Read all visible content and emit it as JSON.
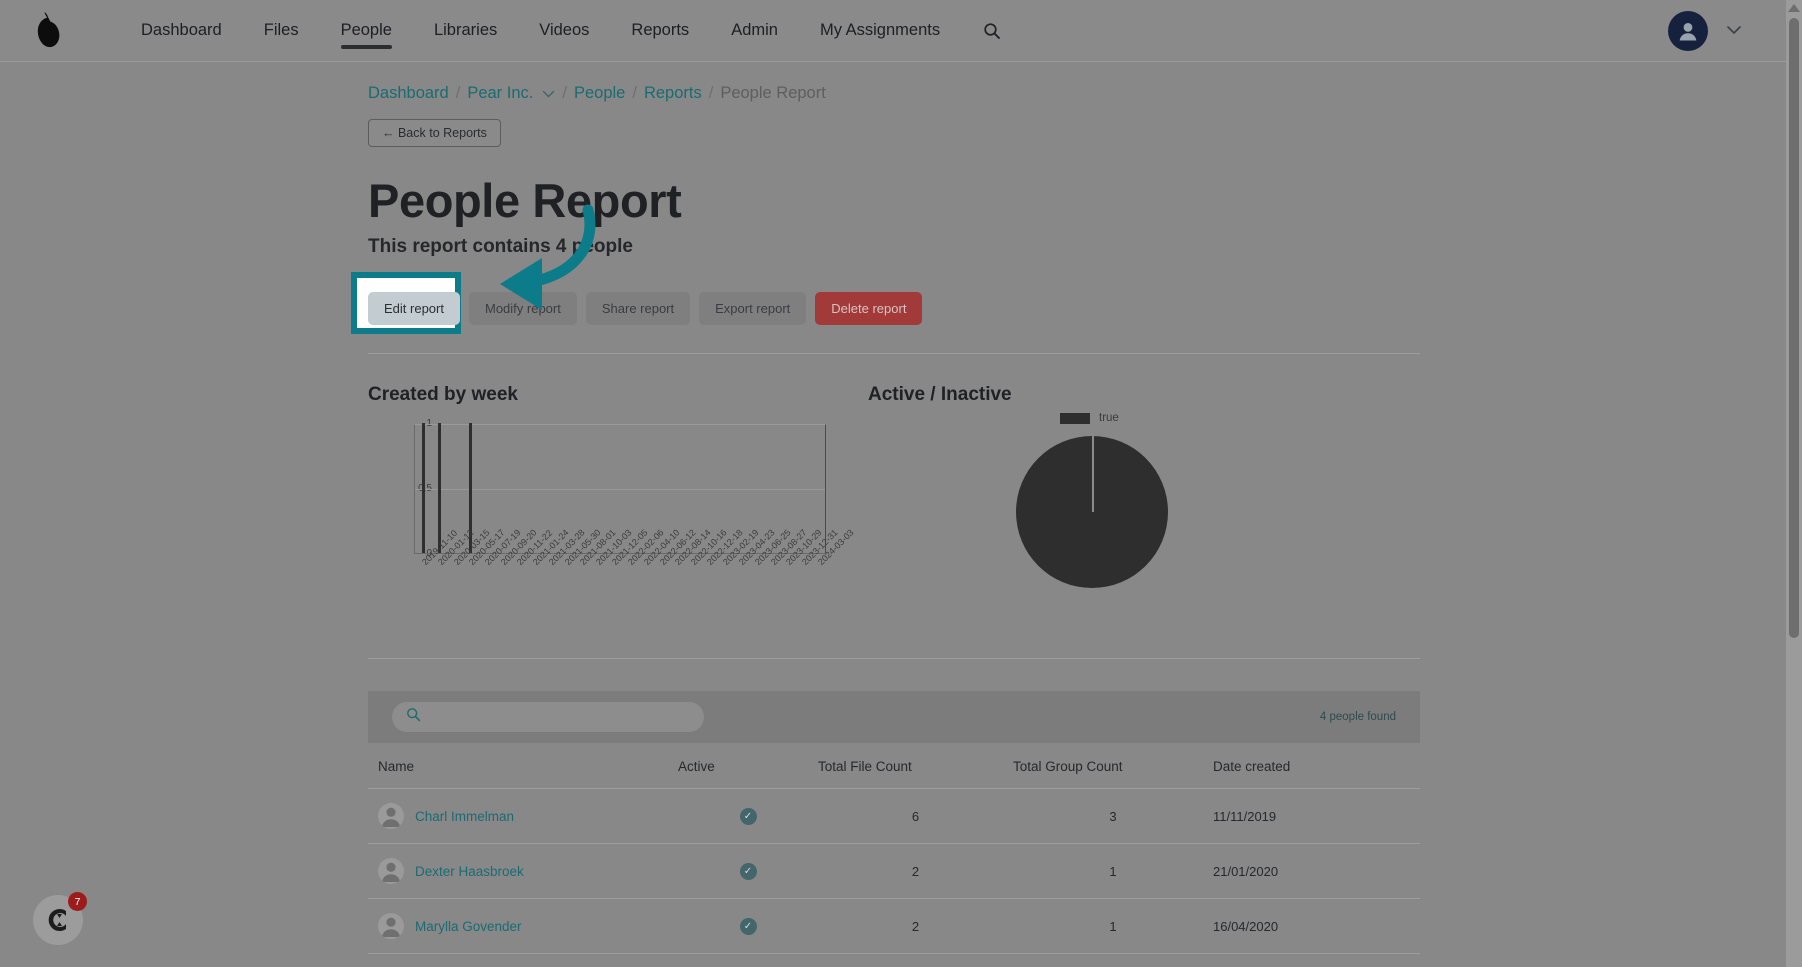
{
  "navbar": {
    "logo_icon": "pear-logo-icon",
    "items": [
      {
        "label": "Dashboard",
        "active": false
      },
      {
        "label": "Files",
        "active": false
      },
      {
        "label": "People",
        "active": true
      },
      {
        "label": "Libraries",
        "active": false
      },
      {
        "label": "Videos",
        "active": false
      },
      {
        "label": "Reports",
        "active": false
      },
      {
        "label": "Admin",
        "active": false
      },
      {
        "label": "My Assignments",
        "active": false
      }
    ],
    "search_icon": "search-icon",
    "account_icon": "user-avatar-icon",
    "account_caret": "⌄"
  },
  "breadcrumb": {
    "items": [
      {
        "label": "Dashboard",
        "current": false
      },
      {
        "label": "Pear Inc.",
        "current": false,
        "caret": true
      },
      {
        "label": "People",
        "current": false
      },
      {
        "label": "Reports",
        "current": false
      },
      {
        "label": "People Report",
        "current": true
      }
    ],
    "separator": "/"
  },
  "back_button": {
    "label": "← Back to Reports"
  },
  "header": {
    "title": "People Report",
    "subtitle": "This report contains 4 people"
  },
  "actions": [
    {
      "label": "Edit report",
      "style": "primary",
      "name": "edit-report-button"
    },
    {
      "label": "Modify report",
      "style": "default",
      "name": "modify-report-button"
    },
    {
      "label": "Share report",
      "style": "default",
      "name": "share-report-button"
    },
    {
      "label": "Export report",
      "style": "default",
      "name": "export-report-button"
    },
    {
      "label": "Delete report",
      "style": "danger",
      "name": "delete-report-button"
    }
  ],
  "annotation": {
    "highlight_target": "Edit report",
    "highlight_color": "#0d7c8a",
    "arrow_color": "#0d7c8a"
  },
  "charts": {
    "bar_title": "Created by week",
    "pie_title": "Active / Inactive"
  },
  "chart_data": [
    {
      "type": "bar",
      "title": "Created by week",
      "xlabel": "",
      "ylabel": "",
      "ylim": [
        0,
        1
      ],
      "yticks": [
        "0",
        "0.5",
        "1"
      ],
      "grid": true,
      "categories": [
        "2019-11-10",
        "2020-01-12",
        "2020-03-15",
        "2020-05-17",
        "2020-07-19",
        "2020-09-20",
        "2020-11-22",
        "2021-01-24",
        "2021-03-28",
        "2021-05-30",
        "2021-08-01",
        "2021-10-03",
        "2021-12-05",
        "2022-02-06",
        "2022-04-10",
        "2022-06-12",
        "2022-08-14",
        "2022-10-16",
        "2022-12-18",
        "2023-02-19",
        "2023-04-23",
        "2023-06-25",
        "2023-08-27",
        "2023-10-29",
        "2023-12-31",
        "2024-03-03"
      ],
      "values": [
        1,
        1,
        0,
        1,
        0,
        0,
        0,
        0,
        0,
        0,
        0,
        0,
        0,
        0,
        0,
        0,
        0,
        0,
        0,
        0,
        0,
        0,
        0,
        0,
        0,
        0
      ]
    },
    {
      "type": "pie",
      "title": "Active / Inactive",
      "legend_position": "top",
      "labels": [
        "true"
      ],
      "values": [
        4
      ],
      "percentages": [
        100
      ],
      "colors": [
        "#2e2e2e"
      ]
    }
  ],
  "table": {
    "search": {
      "value": "",
      "placeholder": "",
      "icon": "search-icon"
    },
    "results_label": "4 people found",
    "columns": [
      "Name",
      "Active",
      "Total File Count",
      "Total Group Count",
      "Date created"
    ],
    "rows": [
      {
        "name": "Charl Immelman",
        "active": true,
        "file_count": "6",
        "group_count": "3",
        "date_created": "11/11/2019"
      },
      {
        "name": "Dexter Haasbroek",
        "active": true,
        "file_count": "2",
        "group_count": "1",
        "date_created": "21/01/2020"
      },
      {
        "name": "Marylla Govender",
        "active": true,
        "file_count": "2",
        "group_count": "1",
        "date_created": "16/04/2020"
      }
    ],
    "active_icon": "check-circle-icon"
  },
  "widget": {
    "badge_count": "7",
    "icon": "chat-widget-icon"
  },
  "scrollbar": {
    "up_icon": "scroll-up-arrow-icon"
  }
}
